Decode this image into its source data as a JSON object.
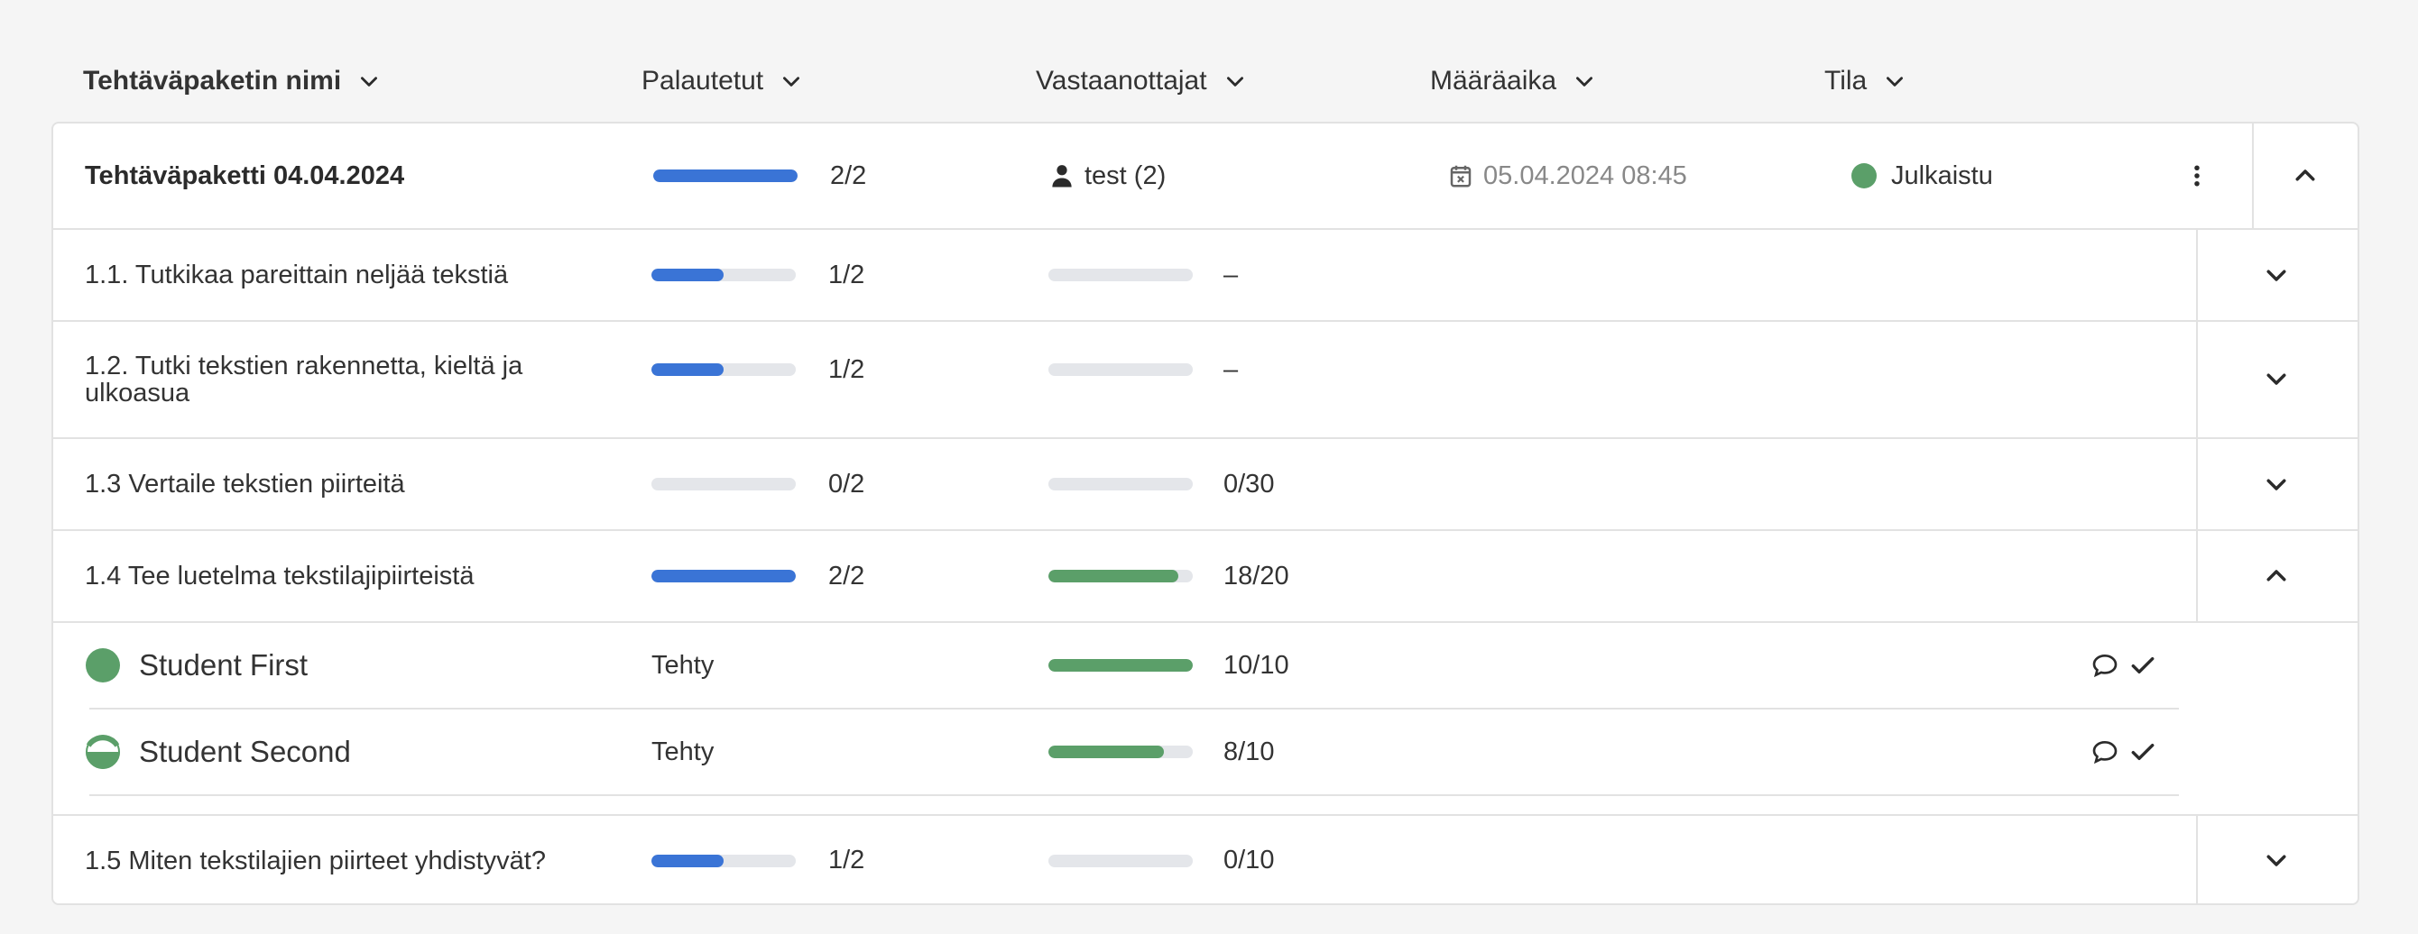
{
  "header": {
    "columns": {
      "name": "Tehtäväpaketin nimi",
      "returned": "Palautetut",
      "recipients": "Vastaanottajat",
      "deadline": "Määräaika",
      "status": "Tila"
    }
  },
  "package": {
    "name": "Tehtäväpaketti 04.04.2024",
    "returned_text": "2/2",
    "returned_progress": 1.0,
    "recipients_text": "test (2)",
    "deadline_text": "05.04.2024 08:45",
    "status_text": "Julkaistu",
    "colors": {
      "published": "#5b9f69",
      "progress_blue": "#3a74d6",
      "progress_green": "#5b9f69"
    }
  },
  "tasks": [
    {
      "name": "1.1. Tutkikaa pareittain neljää tekstiä",
      "returned_text": "1/2",
      "returned_progress": 0.5,
      "score_text": "–",
      "score_progress": 0
    },
    {
      "name": "1.2. Tutki tekstien rakennetta, kieltä ja ulkoasua",
      "returned_text": "1/2",
      "returned_progress": 0.5,
      "score_text": "–",
      "score_progress": 0
    },
    {
      "name": "1.3 Vertaile tekstien piirteitä",
      "returned_text": "0/2",
      "returned_progress": 0,
      "score_text": "0/30",
      "score_progress": 0
    },
    {
      "name": "1.4 Tee luetelma tekstilajipiirteistä",
      "returned_text": "2/2",
      "returned_progress": 1.0,
      "score_text": "18/20",
      "score_progress": 0.9
    },
    {
      "name": "1.5 Miten tekstilajien piirteet yhdistyvät?",
      "returned_text": "1/2",
      "returned_progress": 0.5,
      "score_text": "0/10",
      "score_progress": 0
    }
  ],
  "students": [
    {
      "name": "Student First",
      "status": "Tehty",
      "score_text": "10/10",
      "score_progress": 1.0,
      "avatar": "full-circle"
    },
    {
      "name": "Student Second",
      "status": "Tehty",
      "score_text": "8/10",
      "score_progress": 0.8,
      "avatar": "half-circle"
    }
  ],
  "icons": {
    "sort": "chevron-down-icon",
    "more": "kebab-menu-icon",
    "collapse": "chevron-up-icon",
    "expand": "chevron-down-icon",
    "user": "user-icon",
    "calendar": "calendar-icon",
    "comment": "comment-icon",
    "check": "check-icon"
  }
}
